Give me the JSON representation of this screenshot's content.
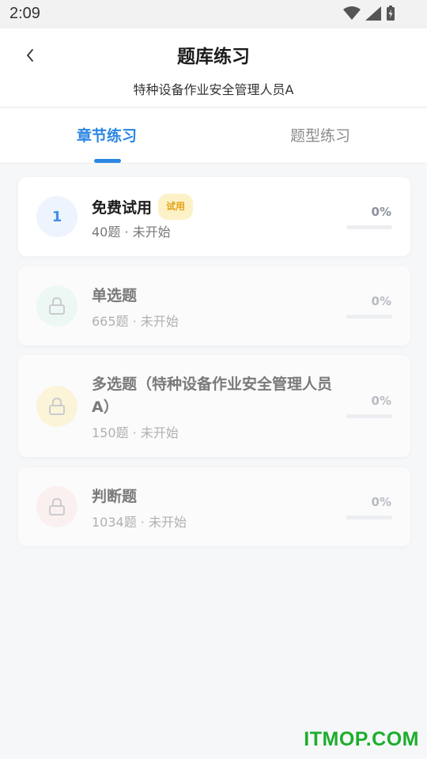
{
  "status_bar": {
    "time": "2:09"
  },
  "header": {
    "title": "题库练习",
    "subtitle": "特种设备作业安全管理人员A"
  },
  "tabs": [
    {
      "label": "章节练习",
      "active": true
    },
    {
      "label": "题型练习",
      "active": false
    }
  ],
  "cards": [
    {
      "badge": "1",
      "title": "免费试用",
      "tag": "试用",
      "meta": "40题 · 未开始",
      "progress_label": "0%",
      "progress": 0,
      "locked": false,
      "circle_color": "#eef4fd"
    },
    {
      "title": "单选题",
      "meta": "665题 · 未开始",
      "progress_label": "0%",
      "progress": 0,
      "locked": true,
      "icon": "lock-icon",
      "circle_color": "#edf7f3"
    },
    {
      "title": "多选题（特种设备作业安全管理人员A）",
      "meta": "150题 · 未开始",
      "progress_label": "0%",
      "progress": 0,
      "locked": true,
      "icon": "lock-icon",
      "circle_color": "#fbf4d8"
    },
    {
      "title": "判断题",
      "meta": "1034题 · 未开始",
      "progress_label": "0%",
      "progress": 0,
      "locked": true,
      "icon": "lock-icon",
      "circle_color": "#fbf0f0"
    }
  ],
  "watermark": "ITMOP.COM",
  "colors": {
    "accent": "#2b87e3",
    "tag_bg": "#fdf1c8",
    "tag_text": "#e3a317"
  }
}
